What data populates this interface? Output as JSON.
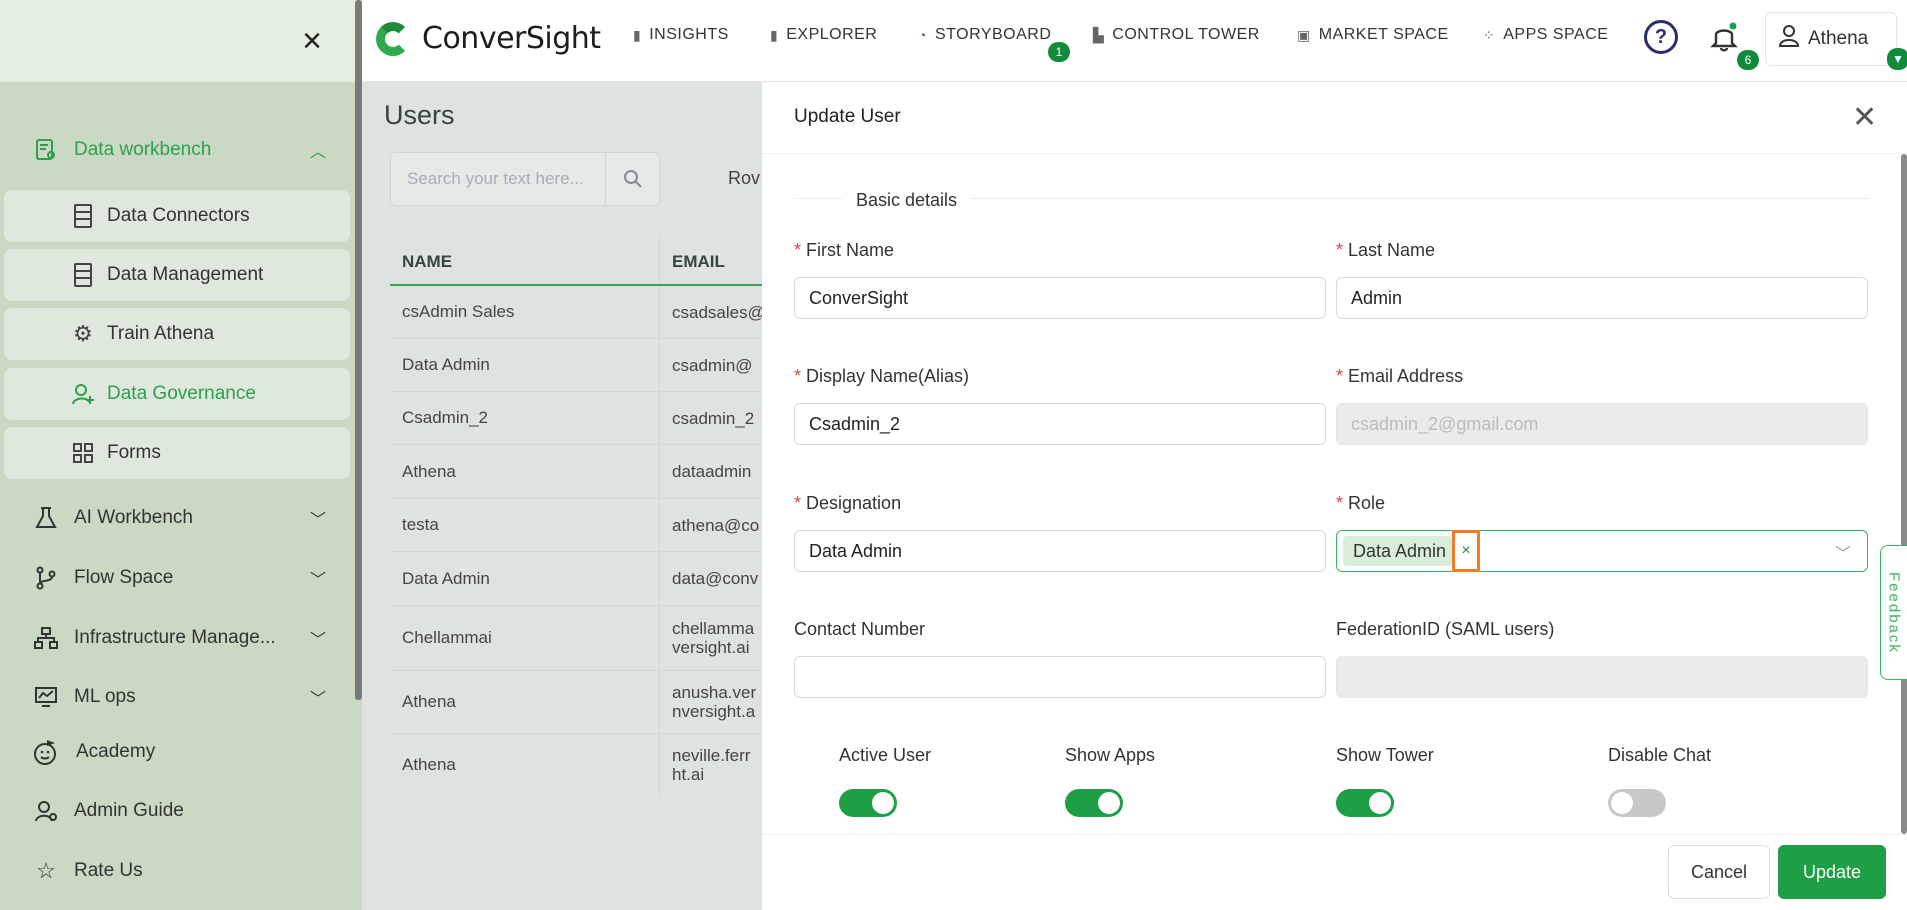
{
  "sidebar": {
    "close_icon": "close-icon",
    "sections": [
      {
        "label": "Data workbench",
        "icon": "data-workbench-icon",
        "expanded": true
      },
      {
        "label": "AI Workbench",
        "icon": "flask-icon"
      },
      {
        "label": "Flow Space",
        "icon": "branch-icon"
      },
      {
        "label": "Infrastructure Manage...",
        "icon": "hierarchy-icon"
      },
      {
        "label": "ML ops",
        "icon": "chart-monitor-icon"
      },
      {
        "label": "Academy",
        "icon": "academy-icon"
      },
      {
        "label": "Admin Guide",
        "icon": "admin-guide-icon"
      },
      {
        "label": "Rate Us",
        "icon": "star-icon"
      }
    ],
    "sub_items": [
      {
        "label": "Data Connectors",
        "icon": "database-icon"
      },
      {
        "label": "Data Management",
        "icon": "database-icon"
      },
      {
        "label": "Train Athena",
        "icon": "gear-icon"
      },
      {
        "label": "Data Governance",
        "icon": "user-add-icon",
        "active": true
      },
      {
        "label": "Forms",
        "icon": "grid-icon"
      }
    ]
  },
  "topbar": {
    "brand": "ConverSight",
    "nav": [
      {
        "label": "INSIGHTS",
        "icon": "bar-chart-icon"
      },
      {
        "label": "EXPLORER",
        "icon": "bar-chart-icon"
      },
      {
        "label": "STORYBOARD",
        "icon": "storyboard-icon",
        "badge": "1"
      },
      {
        "label": "CONTROL TOWER",
        "icon": "tower-icon"
      },
      {
        "label": "MARKET SPACE",
        "icon": "market-icon"
      },
      {
        "label": "APPS SPACE",
        "icon": "apps-icon"
      }
    ],
    "notifications_count": "6",
    "user_name": "Athena"
  },
  "users_page": {
    "title": "Users",
    "search_placeholder": "Search your text here...",
    "rows_label": "Rov",
    "columns": [
      "NAME",
      "EMAIL"
    ],
    "rows": [
      {
        "name": "csAdmin Sales",
        "email": "csadsales@"
      },
      {
        "name": "Data Admin",
        "email": "csadmin@"
      },
      {
        "name": "Csadmin_2",
        "email": "csadmin_2"
      },
      {
        "name": "Athena",
        "email": "dataadmin"
      },
      {
        "name": "testa",
        "email": "athena@co"
      },
      {
        "name": "Data Admin",
        "email": "data@conv"
      },
      {
        "name": "Chellammai",
        "email": "chellamma\nversight.ai"
      },
      {
        "name": "Athena",
        "email": "anusha.ver\nnversight.a"
      },
      {
        "name": "Athena",
        "email": "neville.ferr\nht.ai"
      }
    ]
  },
  "drawer": {
    "title": "Update User",
    "section_label": "Basic details",
    "fields": {
      "first_name": {
        "label": "First Name",
        "value": "ConverSight",
        "required": true
      },
      "last_name": {
        "label": "Last Name",
        "value": "Admin",
        "required": true
      },
      "display_name": {
        "label": "Display Name(Alias)",
        "value": "Csadmin_2",
        "required": true
      },
      "email": {
        "label": "Email Address",
        "value": "csadmin_2@gmail.com",
        "required": true
      },
      "designation": {
        "label": "Designation",
        "value": "Data Admin",
        "required": true
      },
      "role": {
        "label": "Role",
        "tag": "Data Admin",
        "remove_glyph": "×",
        "required": true
      },
      "contact": {
        "label": "Contact Number",
        "value": ""
      },
      "federation": {
        "label": "FederationID (SAML users)",
        "value": ""
      }
    },
    "toggles": [
      {
        "label": "Active User",
        "on": true
      },
      {
        "label": "Show Apps",
        "on": true
      },
      {
        "label": "Show Tower",
        "on": true
      },
      {
        "label": "Disable Chat",
        "on": false
      }
    ],
    "cancel_label": "Cancel",
    "update_label": "Update",
    "feedback_label": "Feedback",
    "colors": {
      "accent": "#1e9e45",
      "highlight": "#f07c2a"
    }
  }
}
